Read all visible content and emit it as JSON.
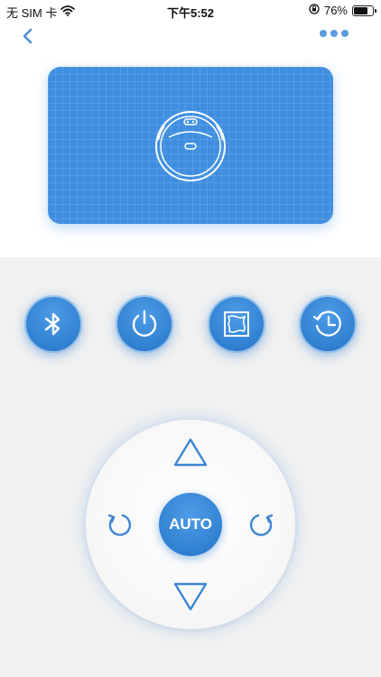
{
  "status_bar": {
    "carrier": "无 SIM 卡",
    "time": "下午5:52",
    "battery_percent": "76%",
    "battery_level": 0.76
  },
  "nav": {
    "back_icon": "chevron-left-icon",
    "more_icon": "more-dots-icon"
  },
  "robot_card": {
    "icon": "robot-vacuum-icon"
  },
  "functions": [
    {
      "name": "bluetooth",
      "icon": "bluetooth-icon"
    },
    {
      "name": "power",
      "icon": "power-icon"
    },
    {
      "name": "edge-clean",
      "icon": "edge-clean-icon"
    },
    {
      "name": "schedule",
      "icon": "schedule-history-icon"
    }
  ],
  "control_pad": {
    "center_label": "AUTO",
    "up_icon": "arrow-up-icon",
    "down_icon": "arrow-down-icon",
    "left_icon": "rotate-left-icon",
    "right_icon": "rotate-right-icon"
  },
  "colors": {
    "accent": "#2f7fd1",
    "card": "#3f8ee0",
    "icon_outline": "#3d86d4",
    "background": "#f1f1f1"
  }
}
